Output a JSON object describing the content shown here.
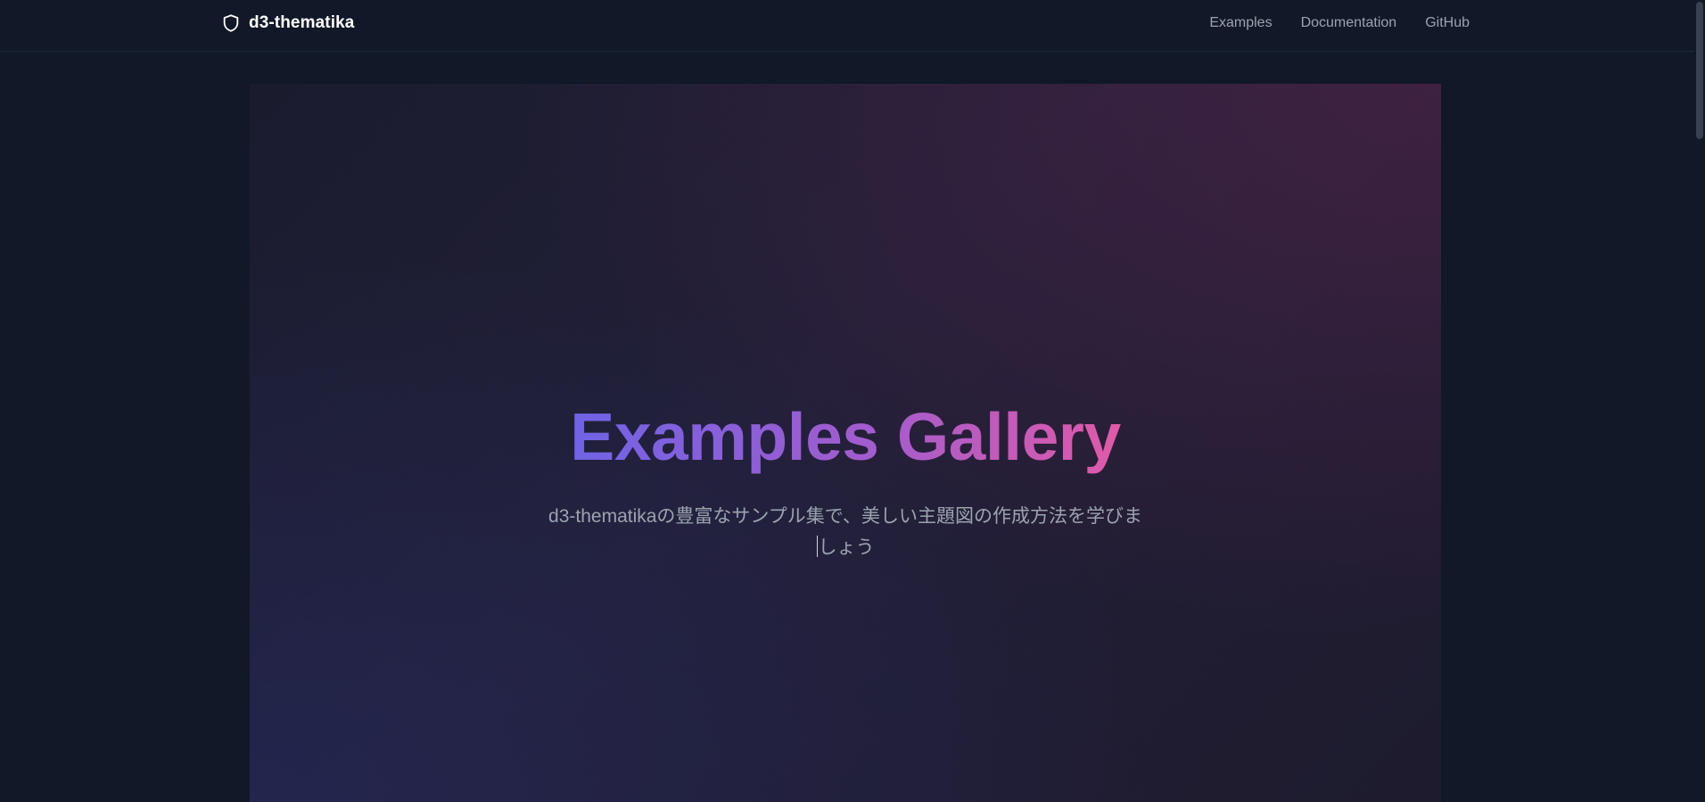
{
  "header": {
    "brand_name": "d3-thematika",
    "brand_icon": "shield-icon",
    "nav": [
      {
        "label": "Examples"
      },
      {
        "label": "Documentation"
      },
      {
        "label": "GitHub"
      }
    ]
  },
  "hero": {
    "title": "Examples Gallery",
    "subtitle_line1": "d3-thematikaの豊富なサンプル集で、美しい主題図の作成方法を学びま",
    "subtitle_line2": "しょう",
    "title_gradient": [
      "#6f63e6",
      "#a35ccd",
      "#e05aa8"
    ]
  },
  "colors": {
    "background": "#111827",
    "nav_text": "#9ca3af",
    "brand_text": "#ffffff"
  }
}
